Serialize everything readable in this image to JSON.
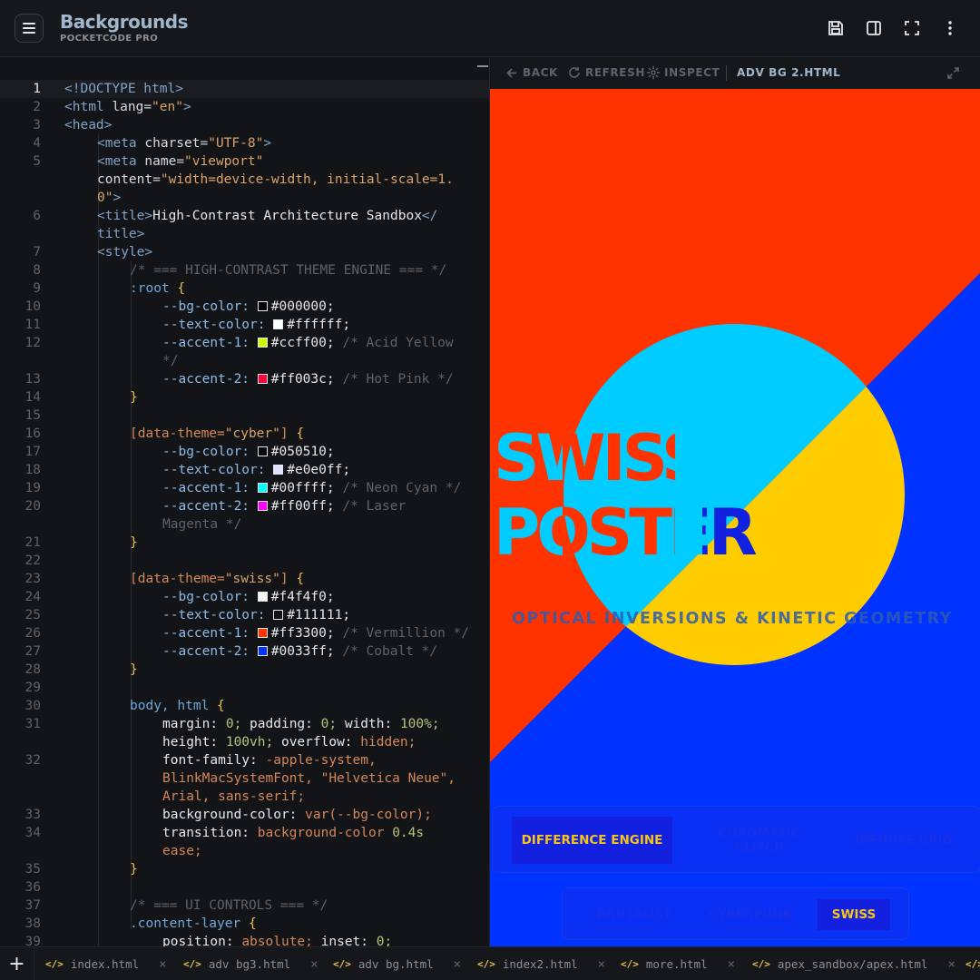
{
  "app": {
    "title": "Backgrounds",
    "subtitle": "POCKETCODE PRO"
  },
  "toolbar_icons": [
    "save-icon",
    "split-view-icon",
    "fullscreen-icon",
    "more-vertical-icon"
  ],
  "preview": {
    "back": "BACK",
    "refresh": "REFRESH",
    "inspect": "INSPECT",
    "file": "ADV BG 2.HTML",
    "poster": {
      "title_line1": "SWISS",
      "title_line2": "POSTER",
      "subtitle": "OPTICAL INVERSIONS & KINETIC GEOMETRY"
    },
    "controls": {
      "modes": [
        "DIFFERENCE ENGINE",
        "CHROMATIC GLITCH",
        "INFINITE GRID"
      ],
      "active_mode": "DIFFERENCE ENGINE",
      "themes": [
        "BRUTALIST",
        "CYBERPUNK",
        "SWISS"
      ],
      "active_theme": "SWISS"
    },
    "colors": {
      "vermillion": "#ff3300",
      "cobalt": "#0033ff",
      "cyan": "#00ccff",
      "yellow": "#ffcc00"
    }
  },
  "editor": {
    "current_line": "1",
    "line_numbers": [
      "1",
      "2",
      "3",
      "4",
      "5",
      "6",
      "7",
      "8",
      "9",
      "10",
      "11",
      "12",
      "13",
      "14",
      "15",
      "16",
      "17",
      "18",
      "19",
      "20",
      "21",
      "22",
      "23",
      "24",
      "25",
      "26",
      "27",
      "28",
      "29",
      "30",
      "31",
      "32",
      "33",
      "34",
      "35",
      "36",
      "37",
      "38",
      "39"
    ],
    "tokens": {
      "doctype": "<!DOCTYPE html>",
      "html_open": "<html",
      "lang_attr": "lang",
      "lang_val": "\"en\"",
      "head_open": "<head>",
      "meta": "<meta",
      "charset_attr": "charset",
      "charset_val": "\"UTF-8\"",
      "name_attr": "name",
      "name_val": "\"viewport\"",
      "content_attr": "content",
      "content_val_a": "\"width=device-width, initial-scale=1.",
      "content_val_b": "0\"",
      "title_open": "<title>",
      "title_text": "High-Contrast Architecture Sandbox",
      "title_close_a": "</",
      "title_close_b": "title>",
      "style_open": "<style>",
      "comment_theme": "/* === HIGH-CONTRAST THEME ENGINE === */",
      "root_sel": ":root",
      "bg_prop": "--bg-color:",
      "text_prop": "--text-color:",
      "acc1_prop": "--accent-1:",
      "acc2_prop": "--accent-2:",
      "root_bg": "#000000;",
      "root_text": "#ffffff;",
      "root_acc1": "#ccff00;",
      "root_acc1_c": "/* Acid Yellow",
      "root_acc1_c2": "*/",
      "root_acc2": "#ff003c;",
      "root_acc2_c": "/* Hot Pink */",
      "cyber_sel_a": "[data-theme=",
      "cyber_sel_val": "\"cyber\"",
      "cyber_bg": "#050510;",
      "cyber_text": "#e0e0ff;",
      "cyber_acc1": "#00ffff;",
      "cyber_acc1_c": "/* Neon Cyan */",
      "cyber_acc2": "#ff00ff;",
      "cyber_acc2_c": "/* Laser",
      "cyber_acc2_c2": "Magenta */",
      "swiss_sel_val": "\"swiss\"",
      "swiss_bg": "#f4f4f0;",
      "swiss_text": "#111111;",
      "swiss_acc1": "#ff3300;",
      "swiss_acc1_c": "/* Vermillion */",
      "swiss_acc2": "#0033ff;",
      "swiss_acc2_c": "/* Cobalt */",
      "body_sel": "body, html",
      "margin": "margin:",
      "zero": "0;",
      "padding": "padding:",
      "width": "width:",
      "hundred": "100%;",
      "height": "height:",
      "vh": "100vh;",
      "overflow": "overflow:",
      "hidden": "hidden;",
      "font_family": "font-family:",
      "font_val_a": "-apple-system,",
      "font_val_b": "BlinkMacSystemFont, \"Helvetica Neue\",",
      "font_val_c": "Arial, sans-serif;",
      "bg_color": "background-color:",
      "var_bg": "var(--bg-color);",
      "transition": "transition:",
      "transition_val": "background-color",
      "dur": "0.4s",
      "ease": "ease;",
      "comment_ui": "/* === UI CONTROLS === */",
      "content_sel": ".content-layer",
      "position": "position:",
      "absolute": "absolute;",
      "inset": "inset:",
      "brace_open": "{",
      "brace_close": "}",
      "gt": ">",
      "eq": "="
    }
  },
  "tabs": [
    {
      "name": "index.html"
    },
    {
      "name": "adv bg3.html"
    },
    {
      "name": "adv bg.html"
    },
    {
      "name": "index2.html"
    },
    {
      "name": "more.html"
    },
    {
      "name": "apex_sandbox/apex.html"
    }
  ],
  "tab_icon": "</>",
  "close_glyph": "×",
  "add_glyph": "+"
}
